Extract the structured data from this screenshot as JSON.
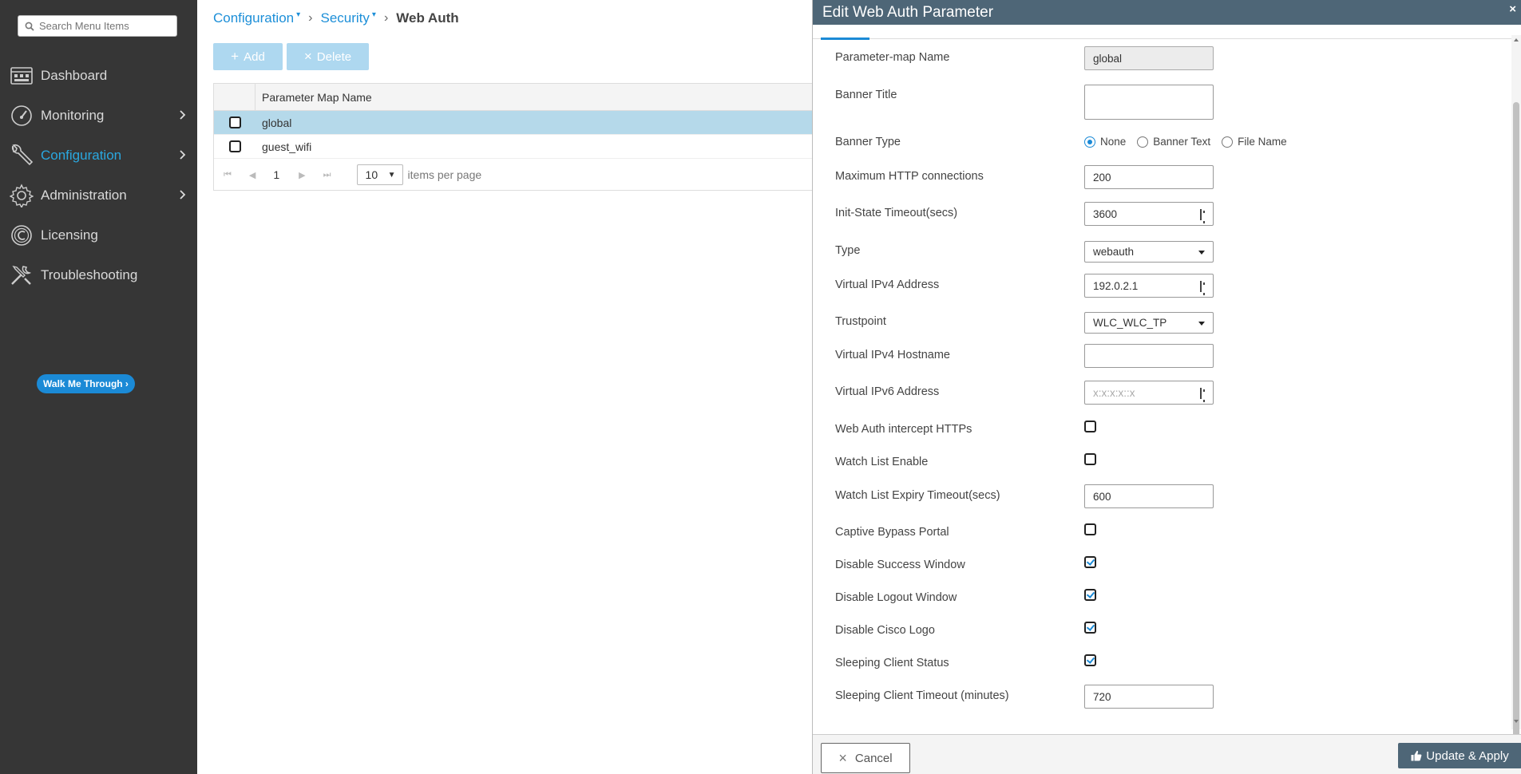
{
  "sidebar": {
    "search_placeholder": "Search Menu Items",
    "items": [
      {
        "label": "Dashboard",
        "icon": "dashboard-icon",
        "has_chevron": false
      },
      {
        "label": "Monitoring",
        "icon": "gauge-icon",
        "has_chevron": true
      },
      {
        "label": "Configuration",
        "icon": "wrench-icon",
        "has_chevron": true,
        "active": true
      },
      {
        "label": "Administration",
        "icon": "gear-icon",
        "has_chevron": true
      },
      {
        "label": "Licensing",
        "icon": "licensing-icon",
        "has_chevron": false
      },
      {
        "label": "Troubleshooting",
        "icon": "tools-icon",
        "has_chevron": false
      }
    ],
    "walk_me_through": "Walk Me Through ›",
    "active_color": "#2aa8e0"
  },
  "breadcrumb": {
    "items": [
      "Configuration",
      "Security"
    ],
    "current": "Web Auth"
  },
  "toolbar": {
    "add_label": "Add",
    "delete_label": "Delete"
  },
  "table": {
    "header": "Parameter Map Name",
    "rows": [
      {
        "name": "global",
        "selected": true
      },
      {
        "name": "guest_wifi",
        "selected": false
      }
    ],
    "pager": {
      "current_page": "1",
      "per_page": "10",
      "per_page_label": "items per page"
    }
  },
  "panel": {
    "title": "Edit Web Auth Parameter",
    "close": "×",
    "fields": {
      "param_map_name": {
        "label": "Parameter-map Name",
        "value": "global"
      },
      "banner_title": {
        "label": "Banner Title",
        "value": ""
      },
      "banner_type": {
        "label": "Banner Type",
        "options": [
          "None",
          "Banner Text",
          "File Name"
        ],
        "selected": "None"
      },
      "max_http": {
        "label": "Maximum HTTP connections",
        "value": "200"
      },
      "init_state_timeout": {
        "label": "Init-State Timeout(secs)",
        "value": "3600"
      },
      "type": {
        "label": "Type",
        "value": "webauth"
      },
      "virtual_ipv4": {
        "label": "Virtual IPv4 Address",
        "value": "192.0.2.1"
      },
      "trustpoint": {
        "label": "Trustpoint",
        "value": "WLC_WLC_TP"
      },
      "virtual_ipv4_hostname": {
        "label": "Virtual IPv4 Hostname",
        "value": ""
      },
      "virtual_ipv6": {
        "label": "Virtual IPv6 Address",
        "placeholder": "x:x:x:x::x"
      },
      "intercept_https": {
        "label": "Web Auth intercept HTTPs",
        "checked": false
      },
      "watch_list_enable": {
        "label": "Watch List Enable",
        "checked": false
      },
      "watch_list_expiry": {
        "label": "Watch List Expiry Timeout(secs)",
        "value": "600"
      },
      "captive_bypass": {
        "label": "Captive Bypass Portal",
        "checked": false
      },
      "disable_success": {
        "label": "Disable Success Window",
        "checked": true
      },
      "disable_logout": {
        "label": "Disable Logout Window",
        "checked": true
      },
      "disable_cisco_logo": {
        "label": "Disable Cisco Logo",
        "checked": true
      },
      "sleeping_client_status": {
        "label": "Sleeping Client Status",
        "checked": true
      },
      "sleeping_client_timeout": {
        "label": "Sleeping Client Timeout (minutes)",
        "value": "720"
      }
    },
    "cancel_label": "Cancel",
    "apply_label": "Update & Apply",
    "header_color": "#4e6677",
    "accent_color": "#1b8ad6"
  }
}
